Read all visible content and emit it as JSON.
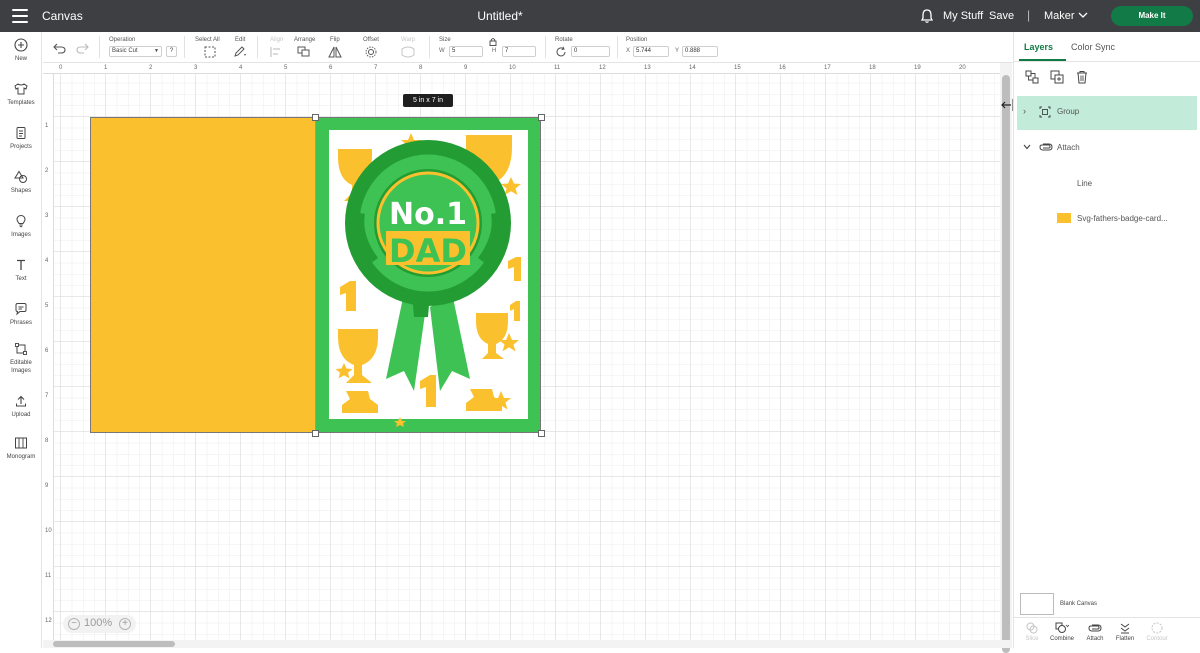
{
  "topbar": {
    "app_title": "Canvas",
    "doc_title": "Untitled*",
    "my_stuff": "My Stuff",
    "save": "Save",
    "separator": "|",
    "machine": "Maker",
    "make_it": "Make It",
    "make_it_color": "#127a46"
  },
  "toolbar": {
    "operation_label": "Operation",
    "operation_value": "Basic Cut",
    "operation_help": "?",
    "select_all_label": "Select All",
    "edit_label": "Edit",
    "align_label": "Align",
    "arrange_label": "Arrange",
    "flip_label": "Flip",
    "offset_label": "Offset",
    "warp_label": "Warp",
    "size_label": "Size",
    "width_label": "W",
    "width_value": "5",
    "height_label": "H",
    "height_value": "7",
    "rotate_label": "Rotate",
    "rotate_value": "0",
    "position_label": "Position",
    "x_label": "X",
    "x_value": "5.744",
    "y_label": "Y",
    "y_value": "0.888"
  },
  "leftnav": {
    "new": "New",
    "templates": "Templates",
    "projects": "Projects",
    "shapes": "Shapes",
    "images": "Images",
    "text": "Text",
    "phrases": "Phrases",
    "editable_images_1": "Editable",
    "editable_images_2": "Images",
    "upload": "Upload",
    "monogram": "Monogram"
  },
  "ruler": {
    "top": [
      "0",
      "1",
      "2",
      "3",
      "4",
      "5",
      "6",
      "7",
      "8",
      "9",
      "10",
      "11",
      "12",
      "13",
      "14",
      "15",
      "16",
      "17",
      "18",
      "19",
      "20"
    ],
    "left": [
      "1",
      "2",
      "3",
      "4",
      "5",
      "6",
      "7",
      "8",
      "9",
      "10",
      "11",
      "12"
    ]
  },
  "canvas": {
    "size_tooltip": "5  in x 7  in",
    "zoom": "100%",
    "zoom_minus": "−",
    "zoom_plus": "+",
    "card_colors": {
      "base": "#fbc02d",
      "green": "#3dc253",
      "dark_green": "#239c33",
      "white": "#ffffff"
    }
  },
  "card_art": {
    "line1": "No.1",
    "line2": "DAD"
  },
  "panel": {
    "tab_layers": "Layers",
    "tab_color_sync": "Color Sync",
    "layers": [
      {
        "label": "Group"
      },
      {
        "label": "Attach"
      },
      {
        "label": "Line"
      },
      {
        "label": "Svg-fathers-badge-card..."
      }
    ],
    "blank_canvas": "Blank Canvas",
    "bottom": {
      "slice": "Slice",
      "combine": "Combine",
      "attach": "Attach",
      "flatten": "Flatten",
      "contour": "Contour"
    }
  }
}
